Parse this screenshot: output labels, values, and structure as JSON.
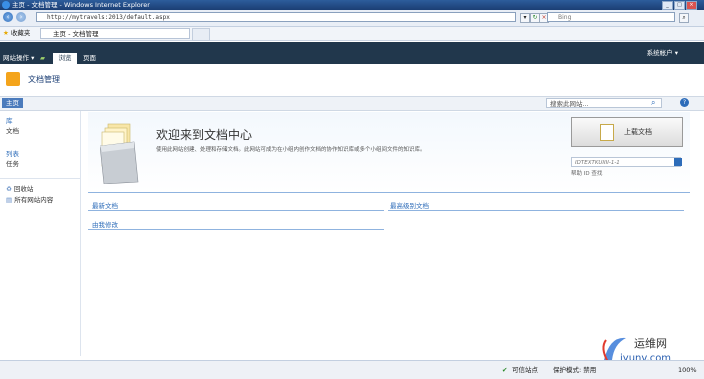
{
  "window": {
    "title": "主页 - 文档管理 - Windows Internet Explorer",
    "buttons": [
      "_",
      "□",
      "×"
    ]
  },
  "browser": {
    "address": "http://mytravels:2013/default.aspx",
    "search_placeholder": "Bing",
    "favorites_label": "收藏夹",
    "tab_title": "主页 - 文档管理"
  },
  "ribbon": {
    "site_actions": "网站操作",
    "tabs": [
      "浏览",
      "页面"
    ],
    "account": "系统帐户"
  },
  "site": {
    "title": "文档管理",
    "home_tab": "主页",
    "search_placeholder": "搜索此网站..."
  },
  "leftnav": {
    "libraries_header": "库",
    "libraries": [
      "文档"
    ],
    "lists_header": "列表",
    "lists": [
      "任务"
    ],
    "recycle_bin": "回收站",
    "all_content": "所有网站内容"
  },
  "hero": {
    "title": "欢迎来到文档中心",
    "description": "使用此网站创建、处理和存储文档。此网站可成为在小组内创作文档的协作知识库或多个小组间文件的知识库。",
    "upload_label": "上载文档",
    "id_placeholder": "IDTEXTKUIIII-1-1",
    "id_links": "帮助  ID  查找"
  },
  "webparts": {
    "recent": "最新文档",
    "top_rated": "最高级别文档",
    "modified_by_me": "由我修改"
  },
  "status": {
    "zone": "可信站点",
    "protected_mode": "保护模式: 禁用",
    "zoom": "100%"
  },
  "watermark": {
    "cn": "运维网",
    "en": "iyunv.com"
  }
}
